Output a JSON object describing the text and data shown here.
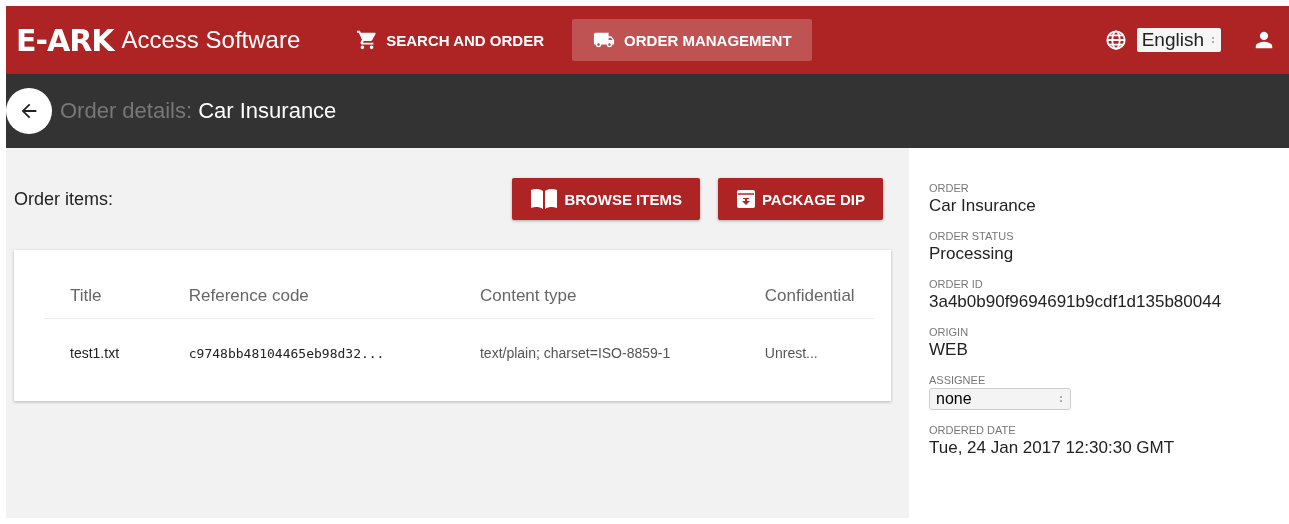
{
  "header": {
    "logo": "E-ARK",
    "app_name": "Access Software",
    "nav": [
      {
        "label": "SEARCH AND ORDER",
        "kind": "cart",
        "selected": false
      },
      {
        "label": "ORDER MANAGEMENT",
        "kind": "truck",
        "selected": true
      }
    ],
    "language": "English"
  },
  "title_bar": {
    "prefix": "Order details:",
    "title": "Car Insurance"
  },
  "items_section": {
    "label": "Order items:",
    "buttons": [
      {
        "label": "BROWSE ITEMS",
        "kind": "browse"
      },
      {
        "label": "PACKAGE DIP",
        "kind": "package"
      }
    ],
    "table": {
      "columns": [
        "Title",
        "Reference code",
        "Content type",
        "Confidential"
      ],
      "rows": [
        [
          "test1.txt",
          "c9748bb48104465eb98d32...",
          "text/plain; charset=ISO-8859-1",
          "Unrest..."
        ]
      ]
    }
  },
  "details": [
    {
      "label": "ORDER",
      "value": "Car Insurance",
      "kind": "text"
    },
    {
      "label": "ORDER STATUS",
      "value": "Processing",
      "kind": "text"
    },
    {
      "label": "ORDER ID",
      "value": "3a4b0b90f9694691b9cdf1d135b80044",
      "kind": "text"
    },
    {
      "label": "ORIGIN",
      "value": "WEB",
      "kind": "text"
    },
    {
      "label": "ASSIGNEE",
      "value": "none",
      "kind": "select"
    },
    {
      "label": "ORDERED DATE",
      "value": "Tue, 24 Jan 2017 12:30:30 GMT",
      "kind": "text"
    }
  ]
}
